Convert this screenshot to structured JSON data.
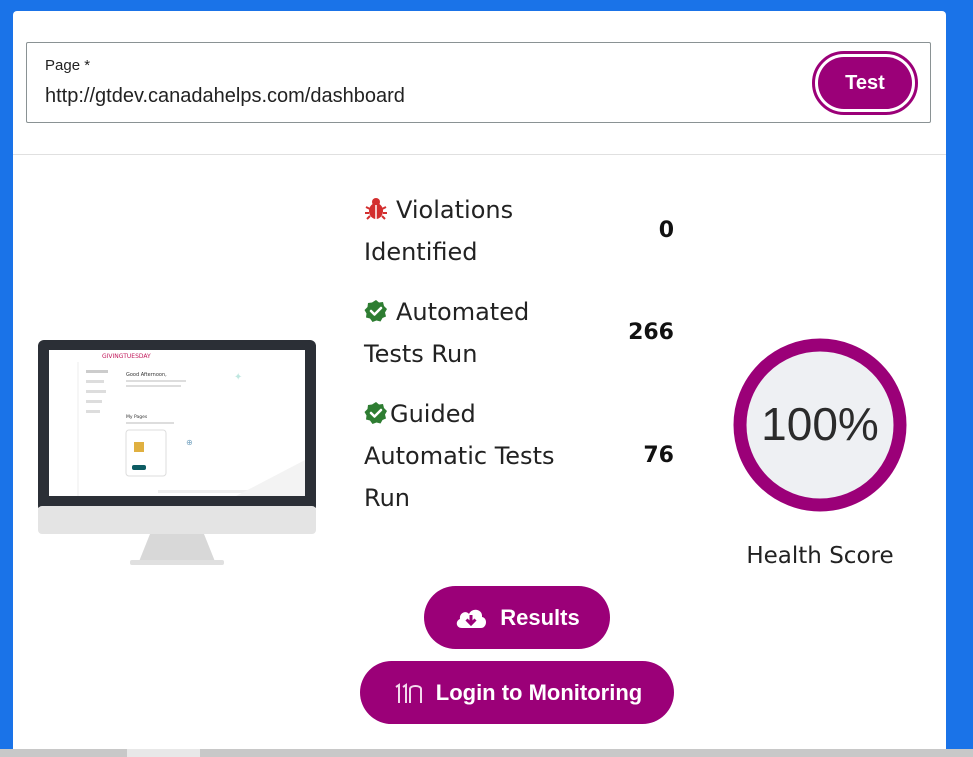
{
  "page_field": {
    "label": "Page *",
    "value": "http://gtdev.canadahelps.com/dashboard",
    "test_button": "Test"
  },
  "stats": [
    {
      "label_line1": "Violations",
      "label_line2": "Identified",
      "label_line3": "",
      "value": "0",
      "icon": "bug-icon"
    },
    {
      "label_line1": "Automated",
      "label_line2": "Tests Run",
      "label_line3": "",
      "value": "266",
      "icon": "check-badge-icon"
    },
    {
      "label_line1": "Guided",
      "label_line2": "Automatic Tests",
      "label_line3": "Run",
      "value": "76",
      "icon": "check-badge-icon"
    }
  ],
  "health": {
    "percent": 100,
    "display": "100%",
    "label": "Health Score"
  },
  "buttons": {
    "results": "Results",
    "login": "Login to Monitoring"
  },
  "colors": {
    "accent": "#9b0078",
    "bug": "#d32f2f",
    "check": "#2e7d32",
    "background": "#1a73e8"
  }
}
